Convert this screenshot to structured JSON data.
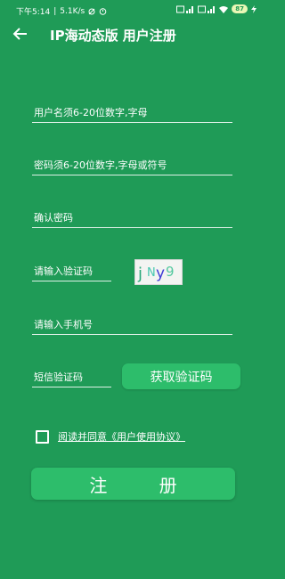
{
  "status_bar": {
    "time": "下午5:14",
    "net_speed": "5.1K/s",
    "battery": "87"
  },
  "header": {
    "title": "IP海动态版 用户注册"
  },
  "form": {
    "username_placeholder": "用户名须6-20位数字,字母",
    "password_placeholder": "密码须6-20位数字,字母或符号",
    "confirm_placeholder": "确认密码",
    "captcha_placeholder": "请输入验证码",
    "captcha_text": "jNy9",
    "phone_placeholder": "请输入手机号",
    "sms_placeholder": "短信验证码",
    "get_code_label": "获取验证码",
    "agree_text": "阅读并同意《用户使用协议》",
    "submit_label": "注  册"
  },
  "colors": {
    "background": "#1f9b57",
    "button": "#2dbd6b"
  },
  "icons": {
    "back": "arrow-left-icon",
    "checkbox": "checkbox-icon"
  }
}
